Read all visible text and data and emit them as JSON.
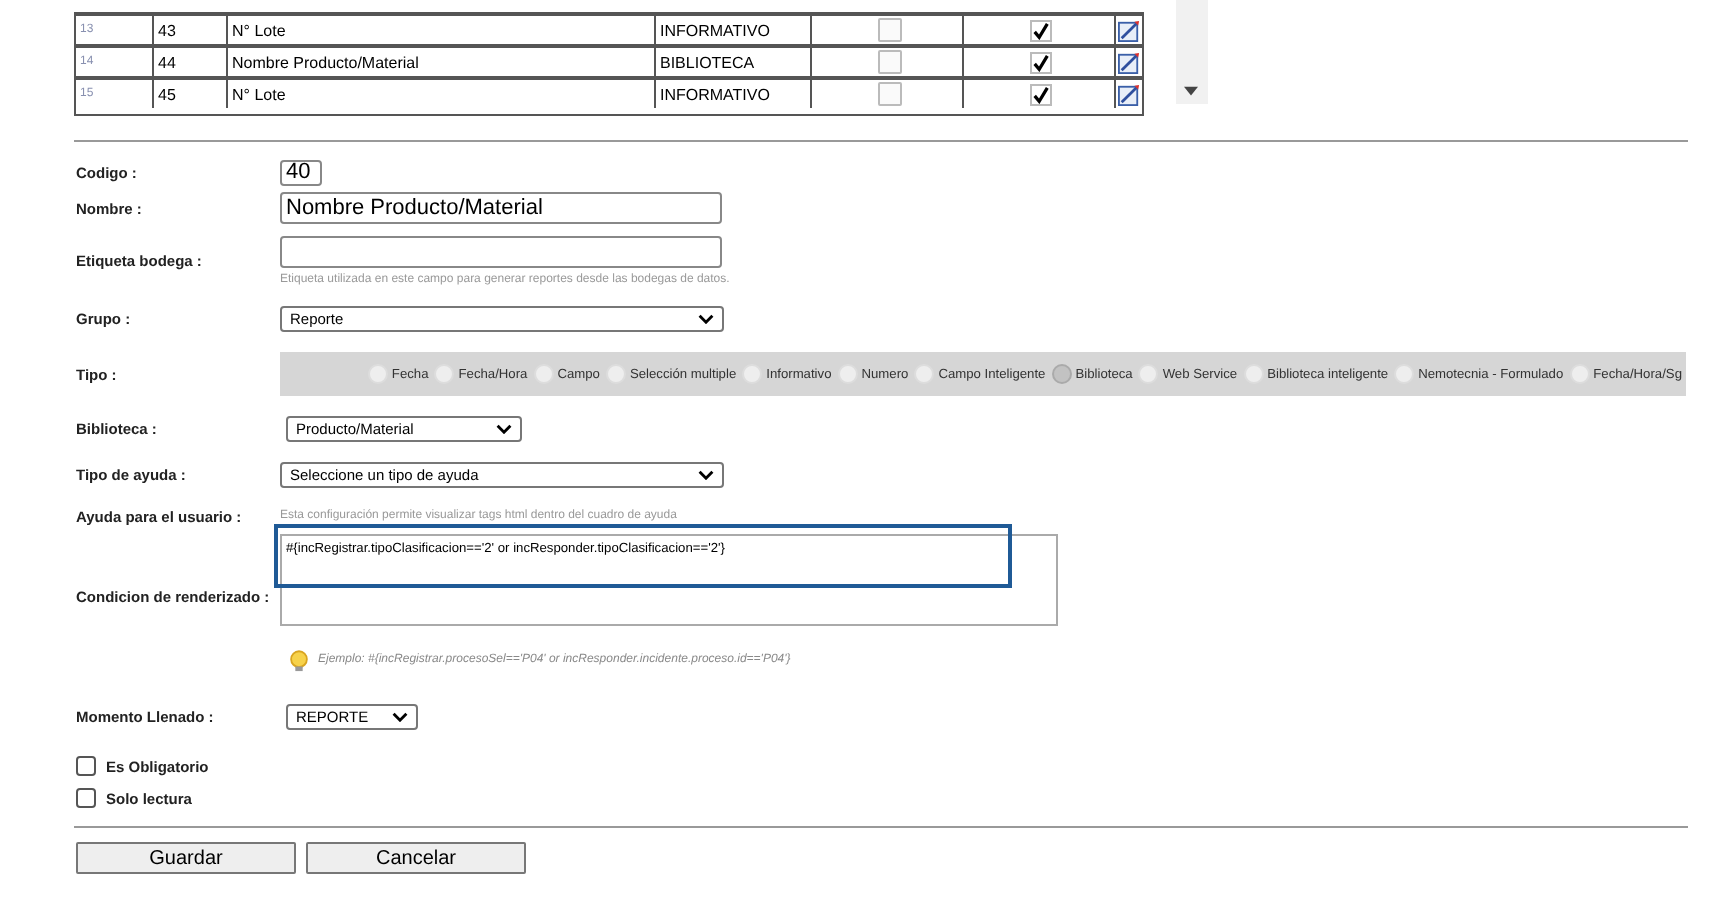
{
  "table": {
    "rows": [
      {
        "index": "13",
        "code": "43",
        "name": "N° Lote",
        "type": "INFORMATIVO",
        "flag": false,
        "checked": true
      },
      {
        "index": "14",
        "code": "44",
        "name": "Nombre Producto/Material",
        "type": "BIBLIOTECA",
        "flag": false,
        "checked": true
      },
      {
        "index": "15",
        "code": "45",
        "name": "N° Lote",
        "type": "INFORMATIVO",
        "flag": false,
        "checked": true
      }
    ]
  },
  "form": {
    "codigo": {
      "label": "Codigo :",
      "value": "40"
    },
    "nombre": {
      "label": "Nombre :",
      "value": "Nombre Producto/Material"
    },
    "etiqueta": {
      "label": "Etiqueta bodega :",
      "hint": "Etiqueta utilizada en este campo para generar reportes desde las bodegas de datos."
    },
    "grupo": {
      "label": "Grupo :",
      "value": "Reporte"
    },
    "tipo": {
      "label": "Tipo :",
      "options": [
        {
          "label": "Fecha",
          "selected": false
        },
        {
          "label": "Fecha/Hora",
          "selected": false
        },
        {
          "label": "Campo",
          "selected": false
        },
        {
          "label": "Selección multiple",
          "selected": false
        },
        {
          "label": "Informativo",
          "selected": false
        },
        {
          "label": "Numero",
          "selected": false
        },
        {
          "label": "Campo Inteligente",
          "selected": false
        },
        {
          "label": "Biblioteca",
          "selected": true
        },
        {
          "label": "Web Service",
          "selected": false
        },
        {
          "label": "Biblioteca inteligente",
          "selected": false
        },
        {
          "label": "Nemotecnia - Formulado",
          "selected": false
        },
        {
          "label": "Fecha/Hora/Sg",
          "selected": false
        }
      ]
    },
    "biblioteca": {
      "label": "Biblioteca :",
      "value": "Producto/Material"
    },
    "tipo_ayuda": {
      "label": "Tipo de ayuda :",
      "value": "Seleccione un tipo de ayuda"
    },
    "ayuda": {
      "label": "Ayuda para el usuario :",
      "hint": "Esta configuración permite visualizar tags html dentro del cuadro de ayuda"
    },
    "condicion": {
      "label": "Condicion de renderizado :",
      "value": "#{incRegistrar.tipoClasificacion=='2' or incResponder.tipoClasificacion=='2'}",
      "example": "Ejemplo: #{incRegistrar.procesoSel=='P04' or incResponder.incidente.proceso.id=='P04'}"
    },
    "momento": {
      "label": "Momento Llenado :",
      "value": "REPORTE"
    },
    "checkboxes": [
      {
        "label": "Es Obligatorio",
        "checked": false
      },
      {
        "label": "Solo lectura",
        "checked": false
      }
    ]
  },
  "buttons": [
    "Guardar",
    "Cancelar"
  ]
}
